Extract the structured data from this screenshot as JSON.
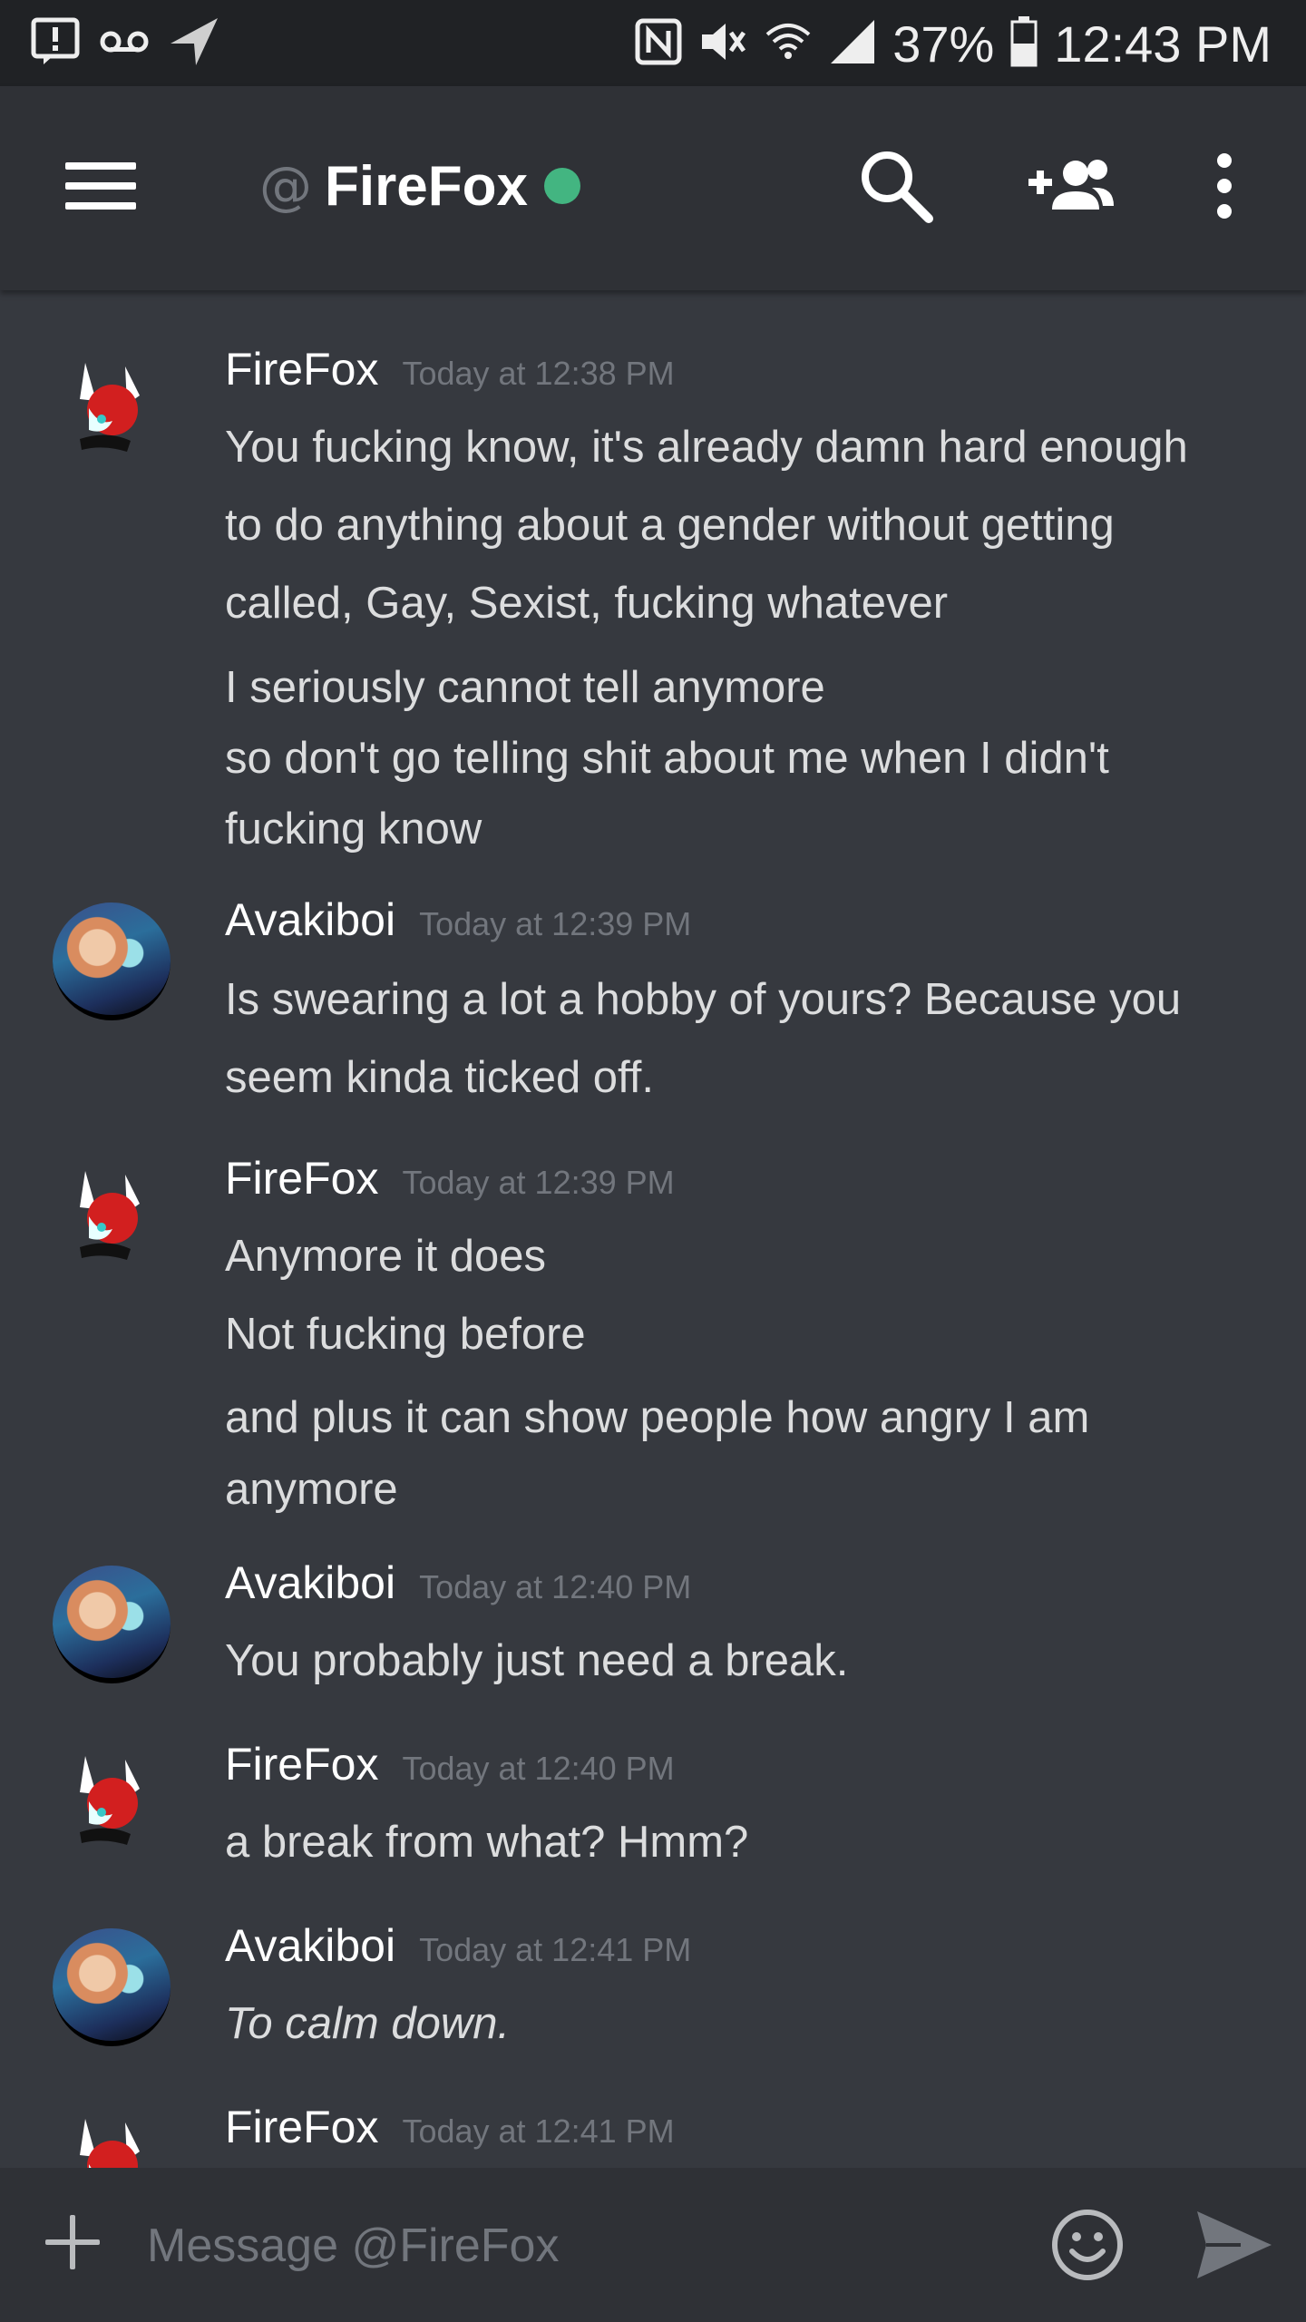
{
  "status_bar": {
    "battery": "37%",
    "time": "12:43 PM",
    "icons_left": [
      "alert-icon",
      "voicemail-icon",
      "send-arrow-icon"
    ],
    "icons_right": [
      "nfc-icon",
      "vibrate-icon",
      "wifi-icon",
      "signal-icon",
      "battery-icon"
    ]
  },
  "header": {
    "at": "@",
    "title": "FireFox",
    "status_color": "#43b581",
    "icons": [
      "menu-icon",
      "search-icon",
      "add-friend-icon",
      "more-vertical-icon"
    ]
  },
  "messages": [
    {
      "author": "FireFox",
      "timestamp": "Today at 12:38 PM",
      "avatar": "firefox-avatar",
      "lines": [
        "You fucking know, it's already damn hard enough",
        "to do anything about a gender without getting",
        "called, Gay, Sexist, fucking whatever",
        "I seriously cannot tell anymore",
        "so don't go telling shit about me when I didn't",
        "fucking know"
      ]
    },
    {
      "author": "Avakiboi",
      "timestamp": "Today at 12:39 PM",
      "avatar": "avakiboi-avatar",
      "lines": [
        "Is swearing a lot a hobby of yours? Because you",
        "seem kinda ticked off."
      ]
    },
    {
      "author": "FireFox",
      "timestamp": "Today at 12:39 PM",
      "avatar": "firefox-avatar",
      "lines": [
        "Anymore it does",
        "Not fucking before",
        "and plus it can show people how angry I am",
        "anymore"
      ]
    },
    {
      "author": "Avakiboi",
      "timestamp": "Today at 12:40 PM",
      "avatar": "avakiboi-avatar",
      "lines": [
        "You probably just need a break."
      ]
    },
    {
      "author": "FireFox",
      "timestamp": "Today at 12:40 PM",
      "avatar": "firefox-avatar",
      "lines": [
        "a break from what? Hmm?"
      ]
    },
    {
      "author": "Avakiboi",
      "timestamp": "Today at 12:41 PM",
      "avatar": "avakiboi-avatar",
      "lines": [
        "To calm down."
      ],
      "italic": true
    },
    {
      "author": "FireFox",
      "timestamp": "Today at 12:41 PM",
      "avatar": "firefox-avatar",
      "lines": []
    }
  ],
  "composer": {
    "placeholder": "Message @FireFox",
    "icons": [
      "plus-icon",
      "emoji-icon",
      "send-icon"
    ]
  }
}
